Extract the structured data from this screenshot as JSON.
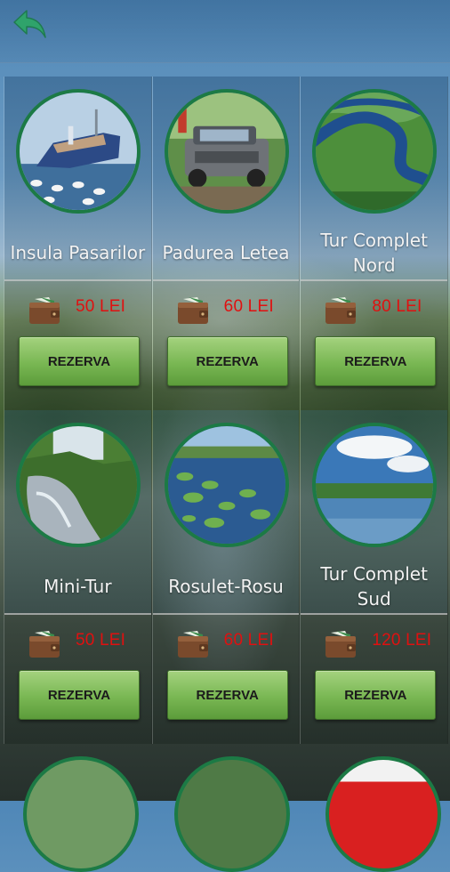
{
  "nav": {
    "back_icon": "back-arrow-icon"
  },
  "colors": {
    "accent_green": "#1c7a45",
    "price_red": "#e01010",
    "button_green": "#79b753"
  },
  "tours": [
    {
      "name": "Insula Pasarilor",
      "price": "50 LEI",
      "button": "REZERVA"
    },
    {
      "name": "Padurea Letea",
      "price": "60 LEI",
      "button": "REZERVA"
    },
    {
      "name": "Tur Complet Nord",
      "price": "80 LEI",
      "button": "REZERVA"
    },
    {
      "name": "Mini-Tur",
      "price": "50 LEI",
      "button": "REZERVA"
    },
    {
      "name": "Rosulet-Rosu",
      "price": "60 LEI",
      "button": "REZERVA"
    },
    {
      "name": "Tur Complet Sud",
      "price": "120 LEI",
      "button": "REZERVA"
    }
  ],
  "wallet_icon": "wallet-icon"
}
